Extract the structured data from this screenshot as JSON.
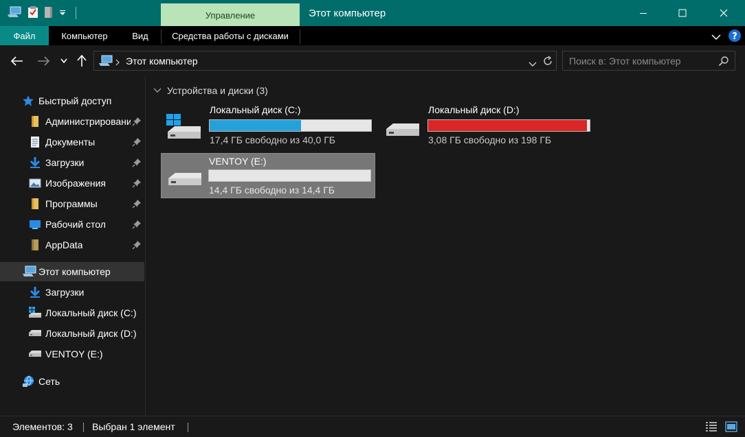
{
  "window": {
    "title": "Этот компьютер",
    "context_tab": "Управление"
  },
  "ribbon": {
    "tabs": [
      "Файл",
      "Компьютер",
      "Вид",
      "Средства работы с дисками"
    ]
  },
  "address": {
    "path": "Этот компьютер",
    "search_placeholder": "Поиск в: Этот компьютер"
  },
  "sidebar": {
    "quick_access": "Быстрый доступ",
    "pinned": [
      {
        "label": "Администрировани",
        "icon": "folder-icon"
      },
      {
        "label": "Документы",
        "icon": "documents-icon"
      },
      {
        "label": "Загрузки",
        "icon": "downloads-icon"
      },
      {
        "label": "Изображения",
        "icon": "pictures-icon"
      },
      {
        "label": "Программы",
        "icon": "folder-icon"
      },
      {
        "label": "Рабочий стол",
        "icon": "desktop-icon"
      },
      {
        "label": "AppData",
        "icon": "folder-icon"
      }
    ],
    "this_pc": "Этот компьютер",
    "this_pc_children": [
      {
        "label": "Загрузки",
        "icon": "downloads-icon"
      },
      {
        "label": "Локальный диск (C:)",
        "icon": "windows-drive-icon"
      },
      {
        "label": "Локальный диск (D:)",
        "icon": "drive-icon"
      },
      {
        "label": "VENTOY (E:)",
        "icon": "drive-icon"
      }
    ],
    "network": "Сеть"
  },
  "content": {
    "group_header": "Устройства и диски (3)",
    "drives": [
      {
        "name": "Локальный диск (C:)",
        "free": "17,4 ГБ свободно из 40,0 ГБ",
        "used_fraction": 0.565,
        "bar_color": "#26a0da",
        "selected": false,
        "windows": true
      },
      {
        "name": "Локальный диск (D:)",
        "free": "3,08 ГБ свободно из 198 ГБ",
        "used_fraction": 0.984,
        "bar_color": "#da2626",
        "selected": false,
        "windows": false
      },
      {
        "name": "VENTOY (E:)",
        "free": "14,4 ГБ свободно из 14,4 ГБ",
        "used_fraction": 0.0,
        "bar_color": "#26a0da",
        "selected": true,
        "windows": false
      }
    ]
  },
  "status": {
    "items_count": "Элементов: 3",
    "selected": "Выбран 1 элемент"
  },
  "colors": {
    "accent": "#006d6a",
    "context_tab": "#b9e4b8",
    "background": "#191919"
  }
}
